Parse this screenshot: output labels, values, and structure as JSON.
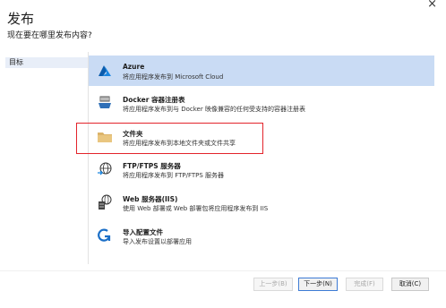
{
  "window": {
    "close_glyph": "×",
    "title": "发布",
    "subtitle": "现在要在哪里发布内容?"
  },
  "nav": {
    "items": [
      {
        "label": "目标",
        "selected": true
      }
    ]
  },
  "options": [
    {
      "title": "Azure",
      "description": "将应用程序发布到 Microsoft Cloud",
      "icon": "azure-icon",
      "selected": true
    },
    {
      "title": "Docker 容器注册表",
      "description": "将应用程序发布到与 Docker 映像兼容的任何受支持的容器注册表",
      "icon": "docker-icon",
      "selected": false
    },
    {
      "title": "文件夹",
      "description": "将应用程序发布到本地文件夹或文件共享",
      "icon": "folder-icon",
      "selected": false
    },
    {
      "title": "FTP/FTPS 服务器",
      "description": "将应用程序发布到 FTP/FTPS 服务器",
      "icon": "ftp-globe-icon",
      "selected": false
    },
    {
      "title": "Web 服务器(IIS)",
      "description": "使用 Web 部署或 Web 部署包将应用程序发布到 IIS",
      "icon": "web-server-icon",
      "selected": false
    },
    {
      "title": "导入配置文件",
      "description": "导入发布设置以部署应用",
      "icon": "import-profile-icon",
      "selected": false
    }
  ],
  "buttons": {
    "back": "上一步(B)",
    "next": "下一步(N)",
    "finish": "完成(F)",
    "cancel": "取消(C)"
  },
  "colors": {
    "selection": "#c9dbf4",
    "highlight_border": "#e3242b",
    "azure_blue": "#0078d4"
  }
}
